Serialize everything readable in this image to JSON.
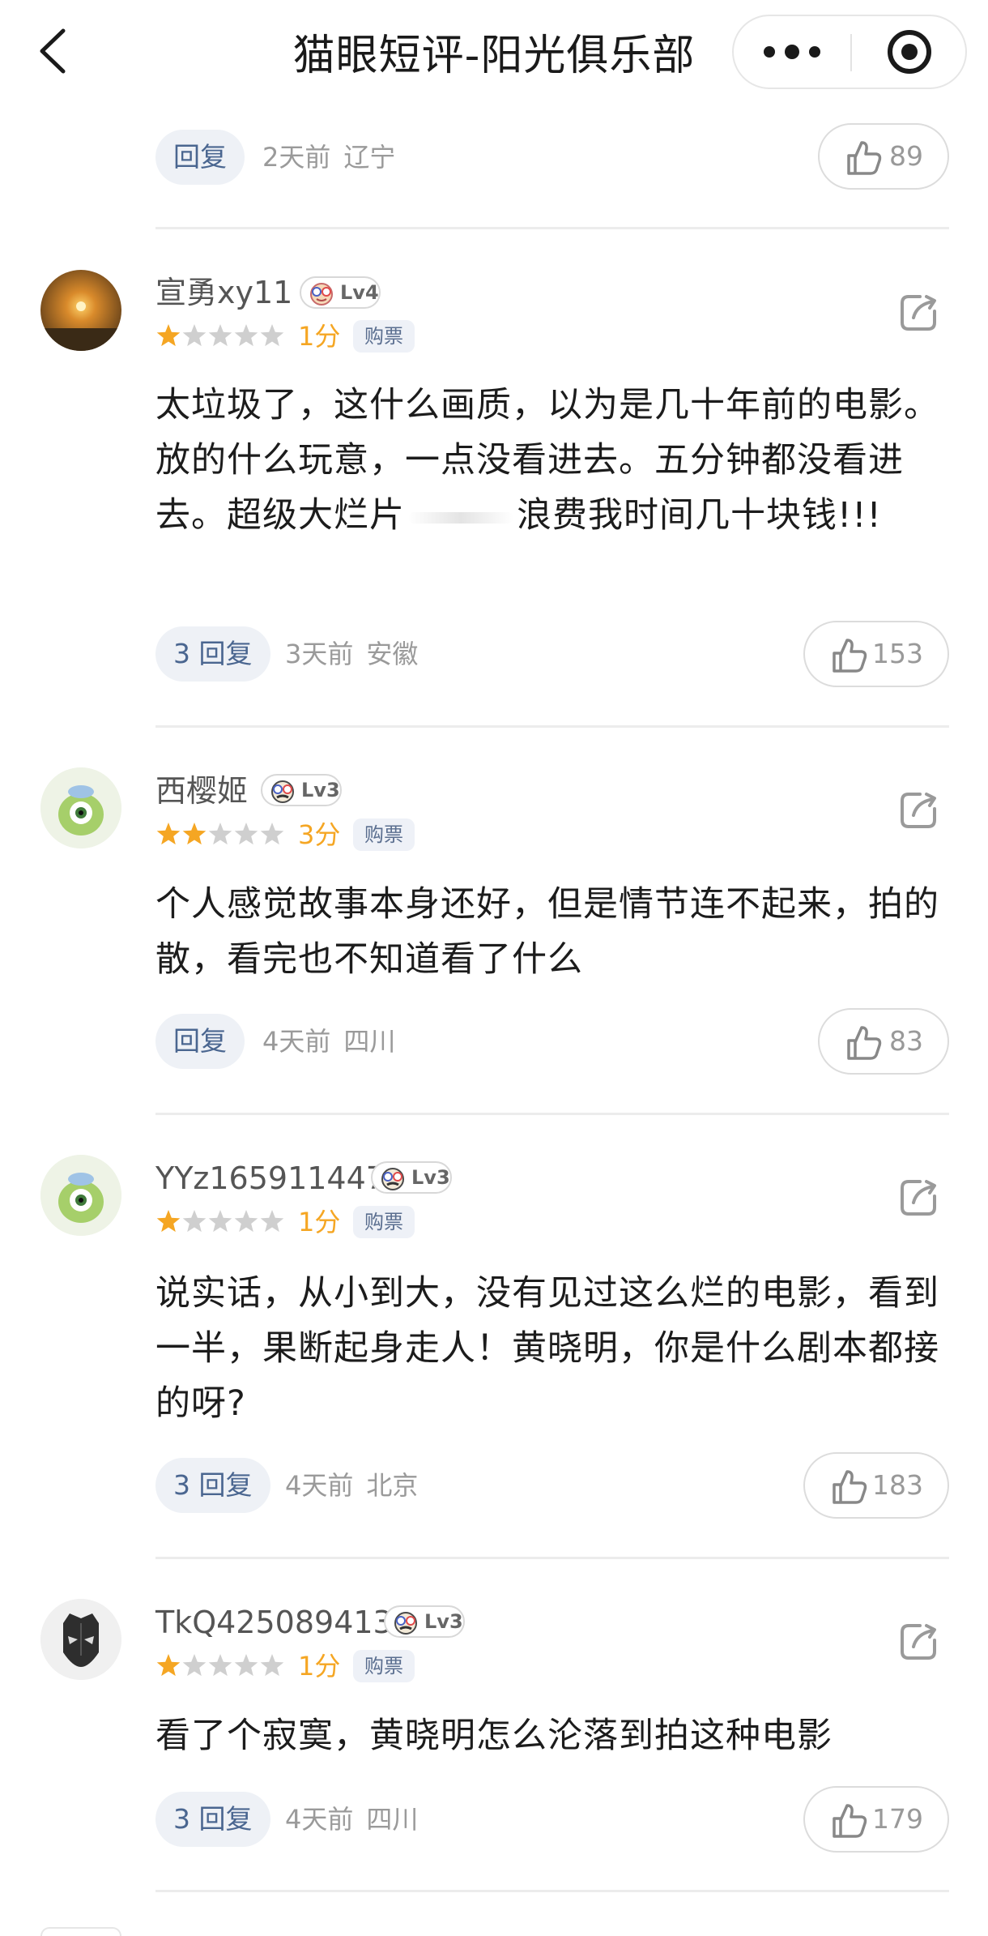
{
  "header": {
    "title": "猫眼短评-阳光俱乐部"
  },
  "top_partial": {
    "reply_label": "回复",
    "time": "2天前",
    "location": "辽宁",
    "likes": "89"
  },
  "reviews": [
    {
      "username": "宣勇xy11",
      "level": "Lv4",
      "rating": 1,
      "score_text": "1分",
      "ticket_label": "购票",
      "content": "太垃圾了，这什么画质，以为是几十年前的电影。放的什么玩意，一点没看进去。五分钟都没看进去。超级大烂片",
      "content_2": "浪费我时间几十块钱!!!",
      "reply_label": "3 回复",
      "time": "3天前",
      "location": "安徽",
      "likes": "153"
    },
    {
      "username": "西樱姬",
      "level": "Lv3",
      "rating": 2,
      "score_text": "3分",
      "ticket_label": "购票",
      "content": "个人感觉故事本身还好，但是情节连不起来，拍的散，看完也不知道看了什么",
      "reply_label": "回复",
      "time": "4天前",
      "location": "四川",
      "likes": "83"
    },
    {
      "username": "YYz165911447",
      "level": "Lv3",
      "rating": 1,
      "score_text": "1分",
      "ticket_label": "购票",
      "content": "说实话，从小到大，没有见过这么烂的电影，看到一半，果断起身走人！黄晓明，你是什么剧本都接的呀?",
      "reply_label": "3 回复",
      "time": "4天前",
      "location": "北京",
      "likes": "183"
    },
    {
      "username": "TkQ425089413",
      "level": "Lv3",
      "rating": 1,
      "score_text": "1分",
      "ticket_label": "购票",
      "content": "看了个寂寞，黄晓明怎么沦落到拍这种电影",
      "reply_label": "3 回复",
      "time": "4天前",
      "location": "四川",
      "likes": "179"
    }
  ],
  "colors": {
    "star_active": "#f5a623",
    "star_inactive": "#cfcfcf",
    "reply_bg": "#eef1f6",
    "reply_text": "#4a6690"
  }
}
